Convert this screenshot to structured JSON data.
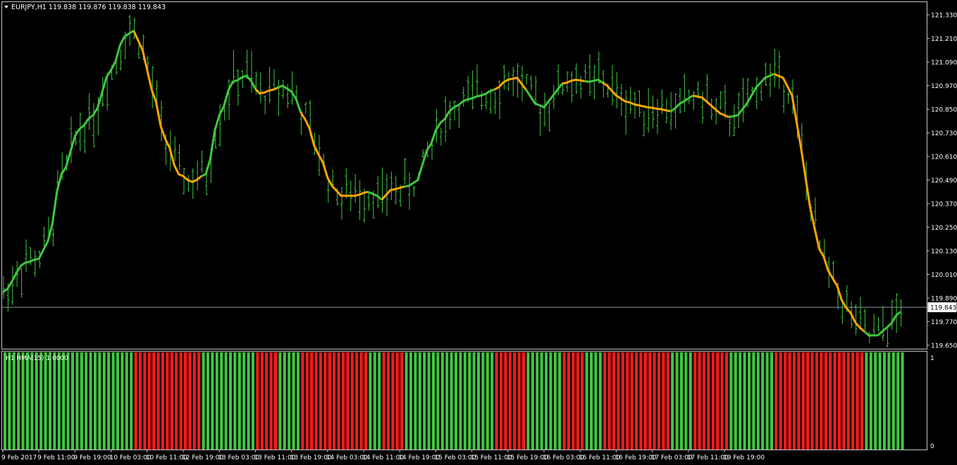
{
  "window": {
    "symbol_header": "EURJPY,H1  119.838 119.876 119.838 119.843",
    "menu_arrow_icon": "triangle-down-icon"
  },
  "subwindow": {
    "indicator_label": "H1 HMA(15) 1.0000",
    "scale_top": "1",
    "scale_bottom": "0"
  },
  "colors": {
    "background": "#000000",
    "frame": "#c8c8c8",
    "bars": "#3fc83f",
    "hma_up": "#3fc83f",
    "hma_down": "#ffa500",
    "hist_up": "#3fc83f",
    "hist_down": "#ff1a1a",
    "price_line": "#8c97a0"
  },
  "chart_data": [
    {
      "type": "line",
      "title": "EURJPY,H1",
      "y_axis_labels": [
        "121.330",
        "121.210",
        "121.090",
        "120.970",
        "120.850",
        "120.730",
        "120.610",
        "120.490",
        "120.370",
        "120.250",
        "120.130",
        "120.010",
        "119.890",
        "119.770",
        "119.650"
      ],
      "ylim": [
        119.632,
        121.395
      ],
      "current_price_label": "119.843",
      "current_price": 119.843,
      "x_labels": [
        "9 Feb 2017",
        "9 Feb 11:00",
        "9 Feb 19:00",
        "10 Feb 03:00",
        "10 Feb 11:00",
        "12 Feb 19:00",
        "13 Feb 03:00",
        "13 Feb 11:00",
        "13 Feb 19:00",
        "14 Feb 03:00",
        "14 Feb 11:00",
        "14 Feb 19:00",
        "15 Feb 03:00",
        "15 Feb 11:00",
        "15 Feb 19:00",
        "16 Feb 03:00",
        "16 Feb 11:00",
        "16 Feb 19:00",
        "17 Feb 03:00",
        "17 Feb 11:00",
        "19 Feb 19:00"
      ],
      "bars_per_label": 8,
      "hma_anchors": [
        [
          0,
          119.92
        ],
        [
          5,
          120.07
        ],
        [
          8,
          120.09
        ],
        [
          10,
          120.18
        ],
        [
          13,
          120.52
        ],
        [
          17,
          120.75
        ],
        [
          20,
          120.82
        ],
        [
          24,
          121.05
        ],
        [
          27,
          121.22
        ],
        [
          29,
          121.25
        ],
        [
          31,
          121.15
        ],
        [
          33,
          120.95
        ],
        [
          36,
          120.7
        ],
        [
          39,
          120.52
        ],
        [
          42,
          120.48
        ],
        [
          45,
          120.52
        ],
        [
          48,
          120.82
        ],
        [
          51,
          120.99
        ],
        [
          54,
          121.02
        ],
        [
          57,
          120.93
        ],
        [
          60,
          120.95
        ],
        [
          62,
          120.97
        ],
        [
          64,
          120.94
        ],
        [
          67,
          120.8
        ],
        [
          70,
          120.62
        ],
        [
          73,
          120.46
        ],
        [
          75,
          120.41
        ],
        [
          78,
          120.41
        ],
        [
          81,
          120.43
        ],
        [
          83,
          120.41
        ],
        [
          84,
          120.39
        ],
        [
          86,
          120.44
        ],
        [
          90,
          120.46
        ],
        [
          92,
          120.49
        ],
        [
          94,
          120.64
        ],
        [
          97,
          120.78
        ],
        [
          100,
          120.86
        ],
        [
          103,
          120.9
        ],
        [
          106,
          120.92
        ],
        [
          109,
          120.95
        ],
        [
          112,
          121.0
        ],
        [
          114,
          121.01
        ],
        [
          116,
          120.95
        ],
        [
          118,
          120.88
        ],
        [
          120,
          120.86
        ],
        [
          122,
          120.92
        ],
        [
          124,
          120.98
        ],
        [
          127,
          121.0
        ],
        [
          130,
          120.99
        ],
        [
          132,
          121.0
        ],
        [
          134,
          120.97
        ],
        [
          136,
          120.92
        ],
        [
          138,
          120.89
        ],
        [
          141,
          120.87
        ],
        [
          143,
          120.86
        ],
        [
          146,
          120.85
        ],
        [
          148,
          120.84
        ],
        [
          151,
          120.89
        ],
        [
          153,
          120.92
        ],
        [
          155,
          120.91
        ],
        [
          157,
          120.87
        ],
        [
          159,
          120.83
        ],
        [
          161,
          120.81
        ],
        [
          163,
          120.82
        ],
        [
          165,
          120.88
        ],
        [
          167,
          120.96
        ],
        [
          169,
          121.01
        ],
        [
          171,
          121.03
        ],
        [
          173,
          121.01
        ],
        [
          175,
          120.92
        ],
        [
          177,
          120.65
        ],
        [
          179,
          120.35
        ],
        [
          181,
          120.14
        ],
        [
          184,
          119.99
        ],
        [
          187,
          119.84
        ],
        [
          190,
          119.74
        ],
        [
          192,
          119.7
        ],
        [
          194,
          119.7
        ],
        [
          196,
          119.74
        ],
        [
          199,
          119.82
        ]
      ],
      "hma_direction_runs": [
        {
          "dir": "up",
          "bars": 29
        },
        {
          "dir": "down",
          "bars": 15
        },
        {
          "dir": "up",
          "bars": 12
        },
        {
          "dir": "down",
          "bars": 5
        },
        {
          "dir": "up",
          "bars": 5
        },
        {
          "dir": "down",
          "bars": 15
        },
        {
          "dir": "up",
          "bars": 3
        },
        {
          "dir": "down",
          "bars": 5
        },
        {
          "dir": "up",
          "bars": 20
        },
        {
          "dir": "down",
          "bars": 7
        },
        {
          "dir": "up",
          "bars": 8
        },
        {
          "dir": "down",
          "bars": 5
        },
        {
          "dir": "up",
          "bars": 4
        },
        {
          "dir": "down",
          "bars": 15
        },
        {
          "dir": "up",
          "bars": 5
        },
        {
          "dir": "down",
          "bars": 8
        },
        {
          "dir": "up",
          "bars": 10
        },
        {
          "dir": "down",
          "bars": 20
        },
        {
          "dir": "up",
          "bars": 4
        }
      ],
      "series": [
        {
          "name": "H1 HMA(15) 1.0000",
          "style": "histogram",
          "up_value": 1,
          "down_value": 1
        }
      ]
    }
  ]
}
